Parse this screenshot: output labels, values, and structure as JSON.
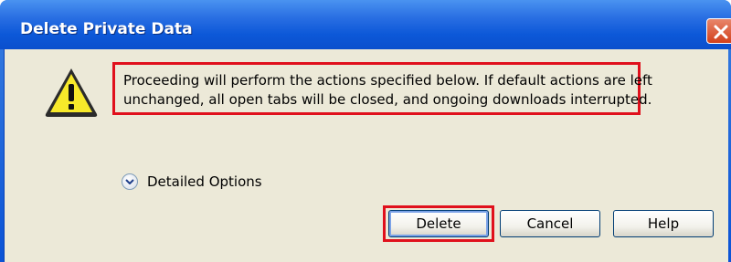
{
  "window": {
    "title": "Delete Private Data",
    "close_icon": "close-icon"
  },
  "dialog": {
    "icon": "warning-icon",
    "message_lines": [
      "Proceeding will perform the actions specified below. If default actions are left",
      "unchanged, all open tabs will be closed, and ongoing downloads interrupted."
    ],
    "details_toggle_label": "Detailed Options",
    "details_icon": "chevron-down-icon"
  },
  "buttons": {
    "delete_label": "Delete",
    "cancel_label": "Cancel",
    "help_label": "Help"
  },
  "colors": {
    "title_bar": "#0c58d8",
    "client_bg": "#ece9d8",
    "highlight": "#e0101c",
    "warning_fill": "#f7e92a"
  }
}
